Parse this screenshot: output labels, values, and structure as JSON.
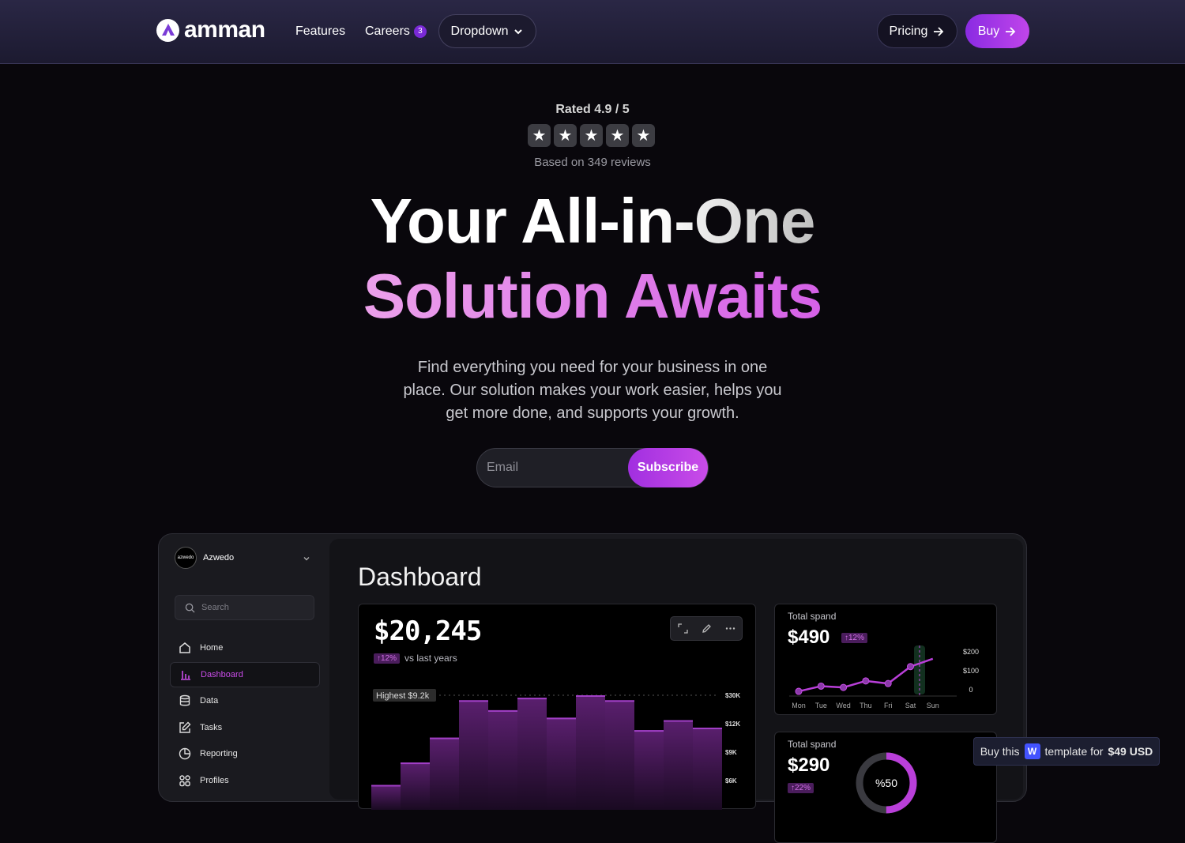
{
  "nav": {
    "logo": "amman",
    "links": {
      "features": "Features",
      "careers": "Careers",
      "careers_badge": "3"
    },
    "dropdown": "Dropdown",
    "pricing": "Pricing",
    "buy": "Buy"
  },
  "rating": {
    "rated": "Rated 4.9 / 5",
    "stars": 5,
    "reviews": "Based on 349 reviews"
  },
  "hero": {
    "line1": "Your All-in-One",
    "line2": "Solution Awaits",
    "subtitle": "Find everything you need for your business in one place. Our solution makes your work easier, helps you get more done, and supports your growth."
  },
  "subscribe_form": {
    "email_placeholder": "Email",
    "button": "Subscribe"
  },
  "dashboard": {
    "org": "Azwedo",
    "org_logo_text": "azwedo",
    "search_placeholder": "Search",
    "menu": [
      "Home",
      "Dashboard",
      "Data",
      "Tasks",
      "Reporting",
      "Profiles"
    ],
    "active_item": "Dashboard",
    "title": "Dashboard",
    "main_card": {
      "amount": "$20,245",
      "change": "↑12%",
      "change_label": "vs last years",
      "highest": "Highest $9.2k",
      "y_ticks": [
        "$30K",
        "$12K",
        "$9K",
        "$6K"
      ],
      "bar_values": [
        2.0,
        3.8,
        5.8,
        8.8,
        8.0,
        9.0,
        7.4,
        9.2,
        8.8,
        6.4,
        7.2,
        6.6
      ]
    },
    "card_spend_1": {
      "title": "Total spand",
      "value": "$490",
      "change": "↑12%",
      "days": [
        "Mon",
        "Tue",
        "Wed",
        "Thu",
        "Fri",
        "Sat",
        "Sun"
      ],
      "y_ticks": [
        "$200",
        "$100",
        "0"
      ],
      "points": [
        15,
        35,
        30,
        55,
        45,
        110,
        140
      ]
    },
    "card_spend_2": {
      "title": "Total spand",
      "value": "$290",
      "change": "↑22%",
      "donut_label": "%50",
      "donut_fraction": 0.5
    }
  },
  "buy_banner": {
    "prefix": "Buy this",
    "middle": "template for",
    "price": "$49 USD",
    "icon_letter": "W"
  },
  "colors": {
    "accent": "#c94ce8",
    "accent_dark": "#8a2be2",
    "bg": "#09070c"
  }
}
